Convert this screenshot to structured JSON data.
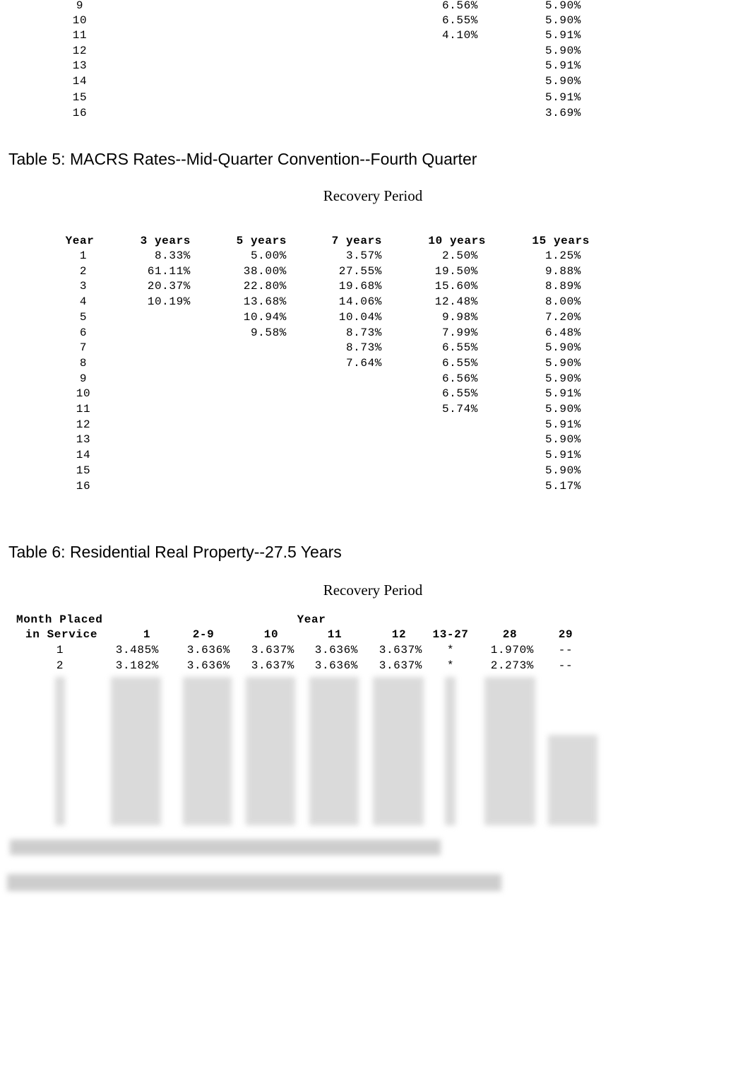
{
  "table4_continued": {
    "rows": [
      {
        "year": "9",
        "y10": "6.56%",
        "y15": "5.90%"
      },
      {
        "year": "10",
        "y10": "6.55%",
        "y15": "5.90%"
      },
      {
        "year": "11",
        "y10": "4.10%",
        "y15": "5.91%"
      },
      {
        "year": "12",
        "y10": "",
        "y15": "5.90%"
      },
      {
        "year": "13",
        "y10": "",
        "y15": "5.91%"
      },
      {
        "year": "14",
        "y10": "",
        "y15": "5.90%"
      },
      {
        "year": "15",
        "y10": "",
        "y15": "5.91%"
      },
      {
        "year": "16",
        "y10": "",
        "y15": "3.69%"
      }
    ]
  },
  "table5": {
    "title": "Table 5: MACRS Rates--Mid-Quarter Convention--Fourth Quarter",
    "subtitle": "Recovery Period",
    "headers": [
      "Year",
      "3 years",
      "5 years",
      "7 years",
      "10 years",
      "15 years"
    ],
    "rows": [
      [
        "1",
        "8.33%",
        "5.00%",
        "3.57%",
        "2.50%",
        "1.25%"
      ],
      [
        "2",
        "61.11%",
        "38.00%",
        "27.55%",
        "19.50%",
        "9.88%"
      ],
      [
        "3",
        "20.37%",
        "22.80%",
        "19.68%",
        "15.60%",
        "8.89%"
      ],
      [
        "4",
        "10.19%",
        "13.68%",
        "14.06%",
        "12.48%",
        "8.00%"
      ],
      [
        "5",
        "",
        "10.94%",
        "10.04%",
        "9.98%",
        "7.20%"
      ],
      [
        "6",
        "",
        "9.58%",
        "8.73%",
        "7.99%",
        "6.48%"
      ],
      [
        "7",
        "",
        "",
        "8.73%",
        "6.55%",
        "5.90%"
      ],
      [
        "8",
        "",
        "",
        "7.64%",
        "6.55%",
        "5.90%"
      ],
      [
        "9",
        "",
        "",
        "",
        "6.56%",
        "5.90%"
      ],
      [
        "10",
        "",
        "",
        "",
        "6.55%",
        "5.91%"
      ],
      [
        "11",
        "",
        "",
        "",
        "5.74%",
        "5.90%"
      ],
      [
        "12",
        "",
        "",
        "",
        "",
        "5.91%"
      ],
      [
        "13",
        "",
        "",
        "",
        "",
        "5.90%"
      ],
      [
        "14",
        "",
        "",
        "",
        "",
        "5.91%"
      ],
      [
        "15",
        "",
        "",
        "",
        "",
        "5.90%"
      ],
      [
        "16",
        "",
        "",
        "",
        "",
        "5.17%"
      ]
    ]
  },
  "table6": {
    "title": "Table 6: Residential Real Property--27.5 Years",
    "subtitle": "Recovery Period",
    "month_header_1": "Month Placed",
    "month_header_2": "in Service",
    "year_header": "Year",
    "headers": [
      "1",
      "2-9",
      "10",
      "11",
      "12",
      "13-27",
      "28",
      "29"
    ],
    "rows": [
      [
        "1",
        "3.485%",
        "3.636%",
        "3.637%",
        "3.636%",
        "3.637%",
        "*",
        "1.970%",
        "--"
      ],
      [
        "2",
        "3.182%",
        "3.636%",
        "3.637%",
        "3.636%",
        "3.637%",
        "*",
        "2.273%",
        "--"
      ]
    ]
  }
}
